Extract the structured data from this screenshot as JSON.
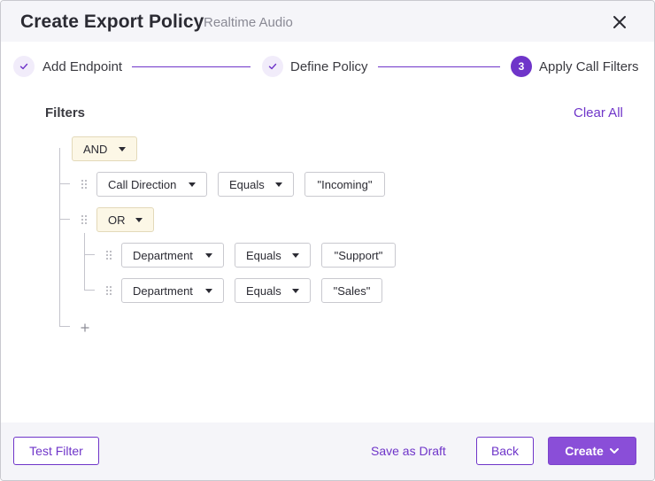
{
  "dialog": {
    "title": "Create Export Policy",
    "subtitle": "Realtime Audio"
  },
  "stepper": {
    "steps": [
      {
        "label": "Add Endpoint",
        "status": "done",
        "marker": "✓"
      },
      {
        "label": "Define Policy",
        "status": "done",
        "marker": "✓"
      },
      {
        "label": "Apply Call Filters",
        "status": "active",
        "marker": "3"
      }
    ]
  },
  "filters": {
    "heading": "Filters",
    "clear_all_label": "Clear All",
    "root_operator": "AND",
    "rule_1": {
      "field": "Call Direction",
      "operator": "Equals",
      "value": "\"Incoming\""
    },
    "group": {
      "operator": "OR",
      "rules": [
        {
          "field": "Department",
          "operator": "Equals",
          "value": "\"Support\""
        },
        {
          "field": "Department",
          "operator": "Equals",
          "value": "\"Sales\""
        }
      ]
    }
  },
  "footer": {
    "test_filter_label": "Test Filter",
    "save_draft_label": "Save as Draft",
    "back_label": "Back",
    "create_label": "Create"
  },
  "colors": {
    "accent": "#6f35c9",
    "primary_button": "#8a4ed8",
    "operator_bg": "#fcf7e6",
    "header_bg": "#f5f5f9"
  },
  "icons": [
    "close-icon",
    "check-icon",
    "caret-down-icon",
    "drag-handle-icon",
    "plus-icon",
    "chevron-down-icon"
  ]
}
